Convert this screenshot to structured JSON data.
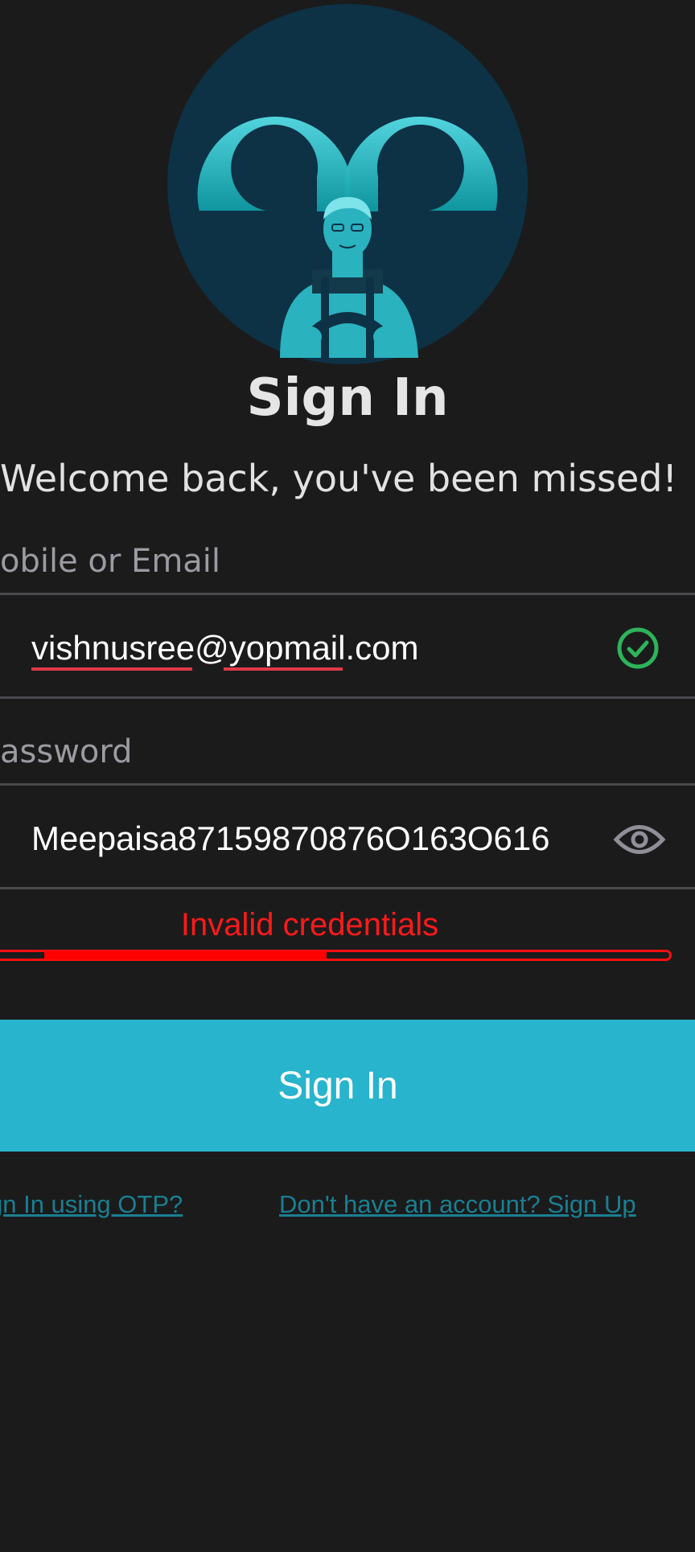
{
  "header": {
    "title": "Sign In",
    "subtitle": "Welcome back, you've been missed!"
  },
  "email_field": {
    "label": "obile or Email",
    "value": "vishnusree@yopmail.com",
    "status_icon": "check-circle-icon",
    "status_color": "#2eb35a"
  },
  "password_field": {
    "label": "assword",
    "value": "Meepaisa87159870876O163O616",
    "toggle_icon": "eye-icon"
  },
  "error": {
    "message": "Invalid credentials",
    "color": "#ff1a1a",
    "strength_fraction": 0.41
  },
  "actions": {
    "signin_label": "Sign In",
    "otp_link": "gn In using OTP?",
    "signup_link": "Don't have an account? Sign Up"
  },
  "colors": {
    "background": "#1b1b1c",
    "accent": "#28b4cc",
    "link": "#1a7f91",
    "logo_circle": "#0d3245",
    "logo_teal": "#3ec9d6"
  }
}
